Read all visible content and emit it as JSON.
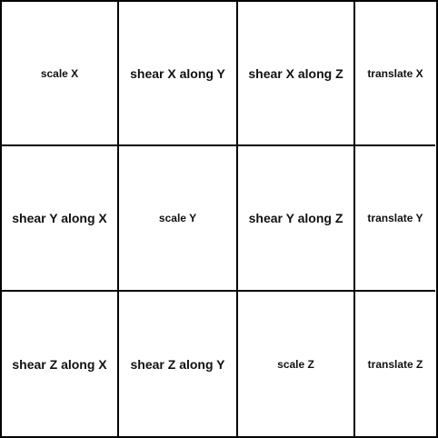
{
  "matrix": {
    "rows": [
      [
        "scale X",
        "shear X along Y",
        "shear X along Z",
        "translate X"
      ],
      [
        "shear Y along X",
        "scale Y",
        "shear Y along Z",
        "translate Y"
      ],
      [
        "shear Z along X",
        "shear Z along Y",
        "scale Z",
        "translate Z"
      ]
    ]
  }
}
